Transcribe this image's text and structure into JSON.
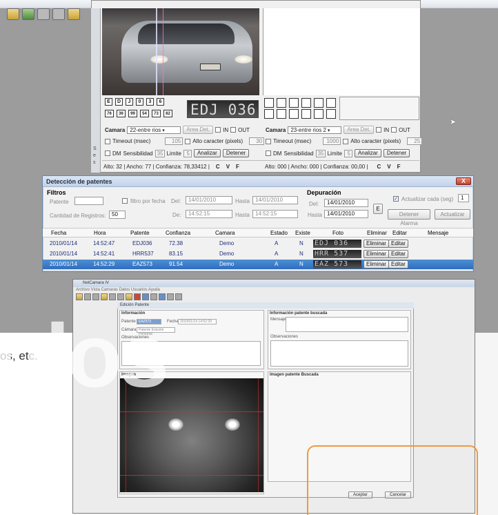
{
  "camera_left": {
    "chars": [
      "E",
      "D",
      "J",
      "0",
      "3",
      "6"
    ],
    "scores": [
      "76",
      "36",
      "99",
      "54",
      "73",
      "82"
    ],
    "plate_crop": "EDJ 036",
    "camera_label": "Camara",
    "camera_value": "22-entre rios",
    "area_button": "Area Det.",
    "in_label": "IN",
    "out_label": "OUT",
    "timeout_label": "Timeout (msec)",
    "timeout_value": "105",
    "alto_label": "Alto caracter (pixels)",
    "alto_value": "30",
    "dm_label": "DM",
    "sensibilidad_label": "Sensibilidad",
    "sensibilidad_value": "35",
    "limite_label": "Limite",
    "limite_value": "5",
    "analizar": "Analizar",
    "detener": "Detener",
    "status": "Alto: 32  |  Ancho: 77  |  Confianza: 78,33412  |",
    "cvf": [
      "C",
      "V",
      "F"
    ]
  },
  "camera_right": {
    "camera_label": "Camara",
    "camera_value": "23-entre rios 2",
    "area_button": "Area Det.",
    "in_label": "IN",
    "out_label": "OUT",
    "timeout_label": "Timeout (msec)",
    "timeout_value": "1000",
    "alto_label": "Alto caracter (pixels)",
    "alto_value": "25",
    "dm_label": "DM",
    "sensibilidad_label": "Sensibilidad",
    "sensibilidad_value": "35",
    "limite_label": "Limite",
    "limite_value": "5",
    "analizar": "Analizar",
    "detener": "Detener",
    "status": "Alto: 000  |  Ancho: 000  |  Confianza: 00,00  |",
    "cvf": [
      "C",
      "V",
      "F"
    ]
  },
  "sidebar_letters": [
    "S",
    "e",
    "s"
  ],
  "detection": {
    "title": "Detección de patentes",
    "close": "X",
    "filtros": "Filtros",
    "patente_label": "Patente",
    "filtro_fecha": "filtro por fecha",
    "del_label": "Del:",
    "del_value": "14/01/2010",
    "hasta_label": "Hasta",
    "hasta_value": "14/01/2010",
    "de_label": "De:",
    "de_time": "14:52:15",
    "hasta_time": "14:52:15",
    "cantidad_label": "Cantidad de Registros:",
    "cantidad_value": "50",
    "depuracion": "Depuración",
    "dep_del_label": "Del:",
    "dep_del_value": "14/01/2010",
    "dep_hasta_label": "Hasta",
    "dep_hasta_value": "14/01/2010",
    "e_button": "E",
    "actualizar_cada": "Actualizar cada (seg)",
    "actualizar_value": "1",
    "detener_alarma": "Detener Alarma",
    "actualizar": "Actualizar",
    "columns": [
      "Fecha",
      "Hora",
      "Patente",
      "Confianza",
      "Camara",
      "Estado",
      "Existe",
      "Foto",
      "Eliminar",
      "Editar",
      "Mensaje"
    ],
    "rows": [
      {
        "fecha": "2010/01/14",
        "hora": "14:52:47",
        "patente": "EDJ036",
        "confianza": "72.38",
        "camara": "Demo",
        "estado": "A",
        "existe": "N",
        "foto": "EDJ 036",
        "eliminar": "Eliminar",
        "editar": "Editar"
      },
      {
        "fecha": "2010/01/14",
        "hora": "14:52:41",
        "patente": "HRR537",
        "confianza": "83.15",
        "camara": "Demo",
        "estado": "A",
        "existe": "N",
        "foto": "HRR 537",
        "eliminar": "Eliminar",
        "editar": "Editar"
      },
      {
        "fecha": "2010/01/14",
        "hora": "14:52:29",
        "patente": "EAZ573",
        "confianza": "91.54",
        "camara": "Demo",
        "estado": "A",
        "existe": "N",
        "foto": "EAZ 573",
        "eliminar": "Eliminar",
        "editar": "Editar"
      }
    ]
  },
  "netcamara": {
    "title": "NetCamara IV",
    "menu": "Archivo   Vista   Camaras   Datos   Usuarios   Ayuda",
    "edit_title": "Edición Patente",
    "info_group": "Información",
    "patente_label": "Patente",
    "patente_value": "EAZ573",
    "fecha_label": "Fecha",
    "fecha_value": "2010/01/14 14:52:29",
    "camara_label": "Cámara",
    "camara_value": "Patente Emisión Personal",
    "observaciones": "Observaciones",
    "info_buscada": "Información patente buscada",
    "mensaje": "Mensaje",
    "obs_right": "Observaciones",
    "imagen": "Imagen",
    "imagen_buscada": "Imagen patente Buscada",
    "aceptar": "Aceptar",
    "cancelar": "Cancelar"
  },
  "watermark": "ulos",
  "partial_text": "os, etc."
}
